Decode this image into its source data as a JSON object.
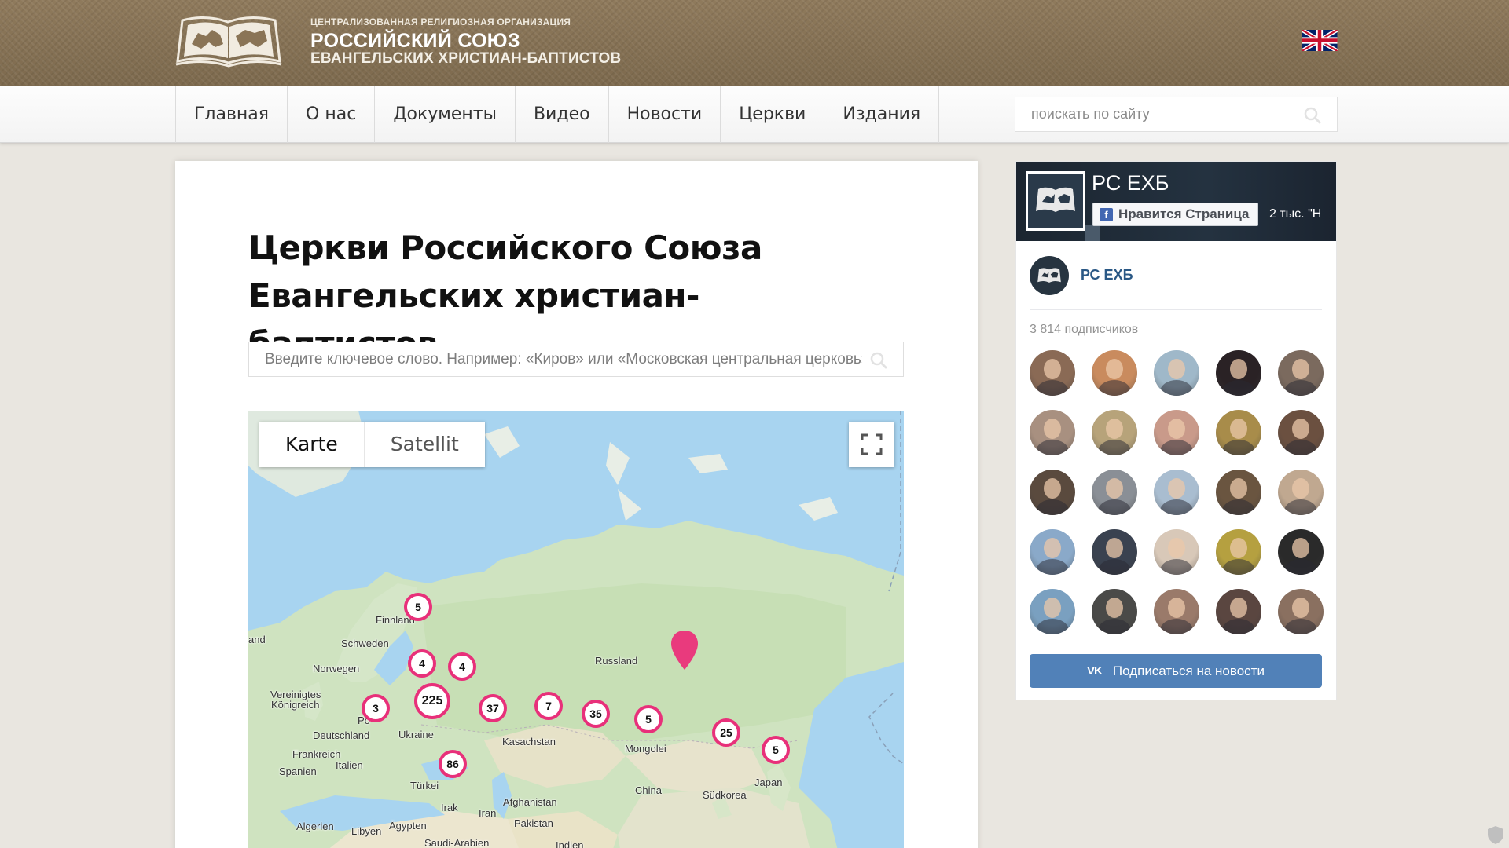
{
  "header": {
    "org_line1": "ЦЕНТРАЛИЗОВАННАЯ РЕЛИГИОЗНАЯ ОРГАНИЗАЦИЯ",
    "org_line2": "РОССИЙСКИЙ СОЮЗ",
    "org_line3": "ЕВАНГЕЛЬСКИХ ХРИСТИАН-БАПТИСТОВ",
    "language_icon": "uk-flag-icon"
  },
  "nav": {
    "items": [
      "Главная",
      "О нас",
      "Документы",
      "Видео",
      "Новости",
      "Церкви",
      "Издания"
    ],
    "search_placeholder": "поискать по сайту"
  },
  "main": {
    "title": "Церкви Российского Союза Евангельских христиан-баптистов",
    "search_placeholder": "Введите ключевое слово. Например: «Киров» или «Московская центральная церковь»"
  },
  "map": {
    "type_active": "Karte",
    "type_inactive": "Satellit",
    "labels": {
      "finnland": "Finnland",
      "schweden": "Schweden",
      "norwegen": "Norwegen",
      "vk": "Vereinigtes",
      "vk2": "Königreich",
      "deutschland": "Deutschland",
      "ukraine": "Ukraine",
      "frankreich": "Frankreich",
      "italien": "Italien",
      "spanien": "Spanien",
      "tuerkei": "Türkei",
      "russland": "Russland",
      "kasachstan": "Kasachstan",
      "mongolei": "Mongolei",
      "china": "China",
      "suedkorea": "Südkorea",
      "japan": "Japan",
      "irak": "Irak",
      "iran": "Iran",
      "afghanistan": "Afghanistan",
      "pakistan": "Pakistan",
      "algerien": "Algerien",
      "libyen": "Libyen",
      "aegypten": "Ägypten",
      "saudi": "Saudi-Arabien",
      "indien": "Indien",
      "land": "and",
      "po": "Po"
    },
    "clusters": {
      "finland": "5",
      "c4a": "4",
      "c4b": "4",
      "uk": "3",
      "moscow": "225",
      "c37": "37",
      "c7": "7",
      "c35": "35",
      "c5mid": "5",
      "c25": "25",
      "c5east": "5",
      "c86": "86"
    }
  },
  "widget": {
    "fb_name": "РС ЕХБ",
    "fb_like": "Нравится Страница",
    "fb_count": "2 тыс. \"Н",
    "vk_name": "РС ЕХБ",
    "vk_subscribers": "3 814 подписчиков",
    "vk_button": "Подписаться на новости",
    "vk_logo": "VK",
    "vk_faces": [
      "#8a6a55",
      "#c98b5e",
      "#9fb8c9",
      "#2a2225",
      "#7b6a5e",
      "#a89080",
      "#b7a37a",
      "#c99a8a",
      "#a88c4a",
      "#6b5040",
      "#5a4a3e",
      "#8a8f96",
      "#a9bdd0",
      "#6a5540",
      "#c0a890",
      "#8aa9c9",
      "#3a4250",
      "#d8c8b8",
      "#b5a040",
      "#2a2a2a",
      "#7aa0c0",
      "#4a4a48",
      "#9a7a6a",
      "#5a4640",
      "#8a7060"
    ]
  }
}
